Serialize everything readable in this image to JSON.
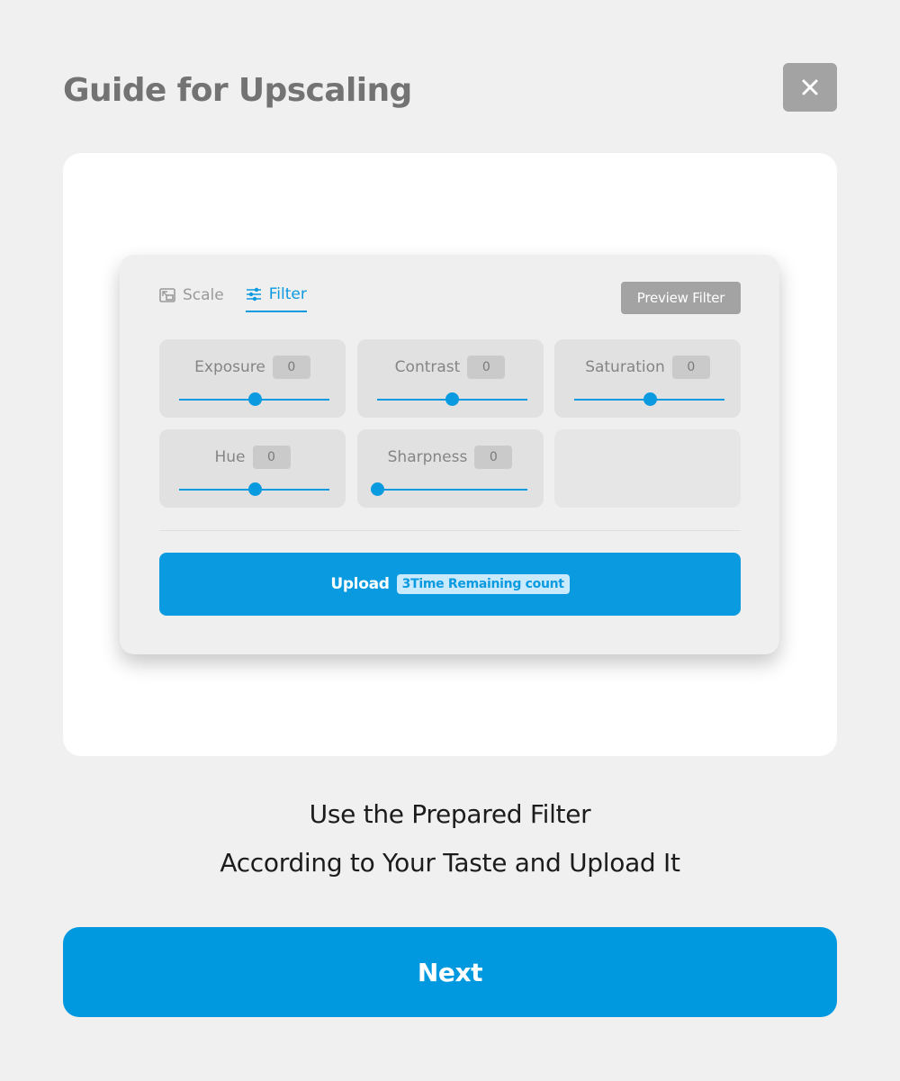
{
  "header": {
    "title": "Guide for Upscaling",
    "close_icon": "close-icon"
  },
  "panel": {
    "tabs": [
      {
        "label": "Scale",
        "icon": "image-scale-icon",
        "active": false
      },
      {
        "label": "Filter",
        "icon": "sliders-icon",
        "active": true
      }
    ],
    "preview_filter_label": "Preview Filter",
    "controls": [
      {
        "label": "Exposure",
        "value": "0",
        "level": 0.5
      },
      {
        "label": "Contrast",
        "value": "0",
        "level": 0.5
      },
      {
        "label": "Saturation",
        "value": "0",
        "level": 0.5
      },
      {
        "label": "Hue",
        "value": "0",
        "level": 0.5
      },
      {
        "label": "Sharpness",
        "value": "0",
        "level": 0.0
      }
    ],
    "upload_label": "Upload",
    "remaining_badge": "3Time Remaining count"
  },
  "caption": {
    "line1": "Use the Prepared Filter",
    "line2": "According to Your Taste and Upload It"
  },
  "next_label": "Next",
  "colors": {
    "accent": "#0a9ae0",
    "background": "#f0f0f0",
    "muted_button": "#a3a3a3"
  }
}
